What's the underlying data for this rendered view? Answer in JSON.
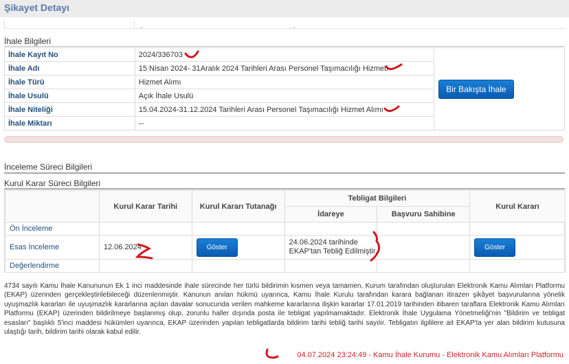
{
  "header": {
    "title": "Şikayet Detayı"
  },
  "ihale": {
    "section_title": "İhale Bilgileri",
    "rows": [
      {
        "label": "İhale Kayıt No",
        "value": "2024/336703"
      },
      {
        "label": "İhale Adı",
        "value": "15 Nisan 2024- 31Aralık 2024 Tarihleri Arası Personel Taşımacılığı Hizmeti"
      },
      {
        "label": "İhale Türü",
        "value": "Hizmet Alımı"
      },
      {
        "label": "İhale Usulü",
        "value": "Açık İhale Usulü"
      },
      {
        "label": "İhale Niteliği",
        "value": "15.04.2024-31.12.2024 Tarihleri Arası Personel Taşımacılığı Hizmet Alımı"
      },
      {
        "label": "İhale Miktarı",
        "value": "--"
      }
    ],
    "overview_button": "Bir Bakışta İhale"
  },
  "inceleme": {
    "section_title": "İnceleme Süreci Bilgileri"
  },
  "kurul": {
    "section_title": "Kurul Karar Süreci Bilgileri",
    "headers": {
      "tarih": "Kurul Karar Tarihi",
      "tutanak": "Kurul Kararı Tutanağı",
      "teblig": "Tebligat Bilgileri",
      "idare": "İdareye",
      "basvuru": "Başvuru Sahibine",
      "karar": "Kurul Kararı"
    },
    "rows": [
      {
        "stage": "Ön İnceleme",
        "tarih": "",
        "idare": ""
      },
      {
        "stage": "Esas İnceleme",
        "tarih": "12.06.2024",
        "idare_line1": "24.06.2024 tarihinde",
        "idare_line2": "EKAP'tan Tebliğ Edilmiştir."
      },
      {
        "stage": "Değerlendirme",
        "tarih": "",
        "idare": ""
      }
    ],
    "show_button": "Göster"
  },
  "notice": "4734 sayılı Kamu İhale Kanununun Ek 1 inci maddesinde ihale sürecinde her türlü bildirimin kısmen veya tamamen, Kurum tarafından oluşturulan Elektronik Kamu Alımları Platformu (EKAP) üzerinden gerçekleştirilebileceği düzenlenmiştir. Kanunun anılan hükmü uyarınca, Kamu İhale Kurulu tarafından karara bağlanan itirazen şikâyet başvurularına yönelik uyuşmazlık kararları ile uyuşmazlık kararlarına açılan davalar sonucunda verilen mahkeme kararlarına ilişkin kararlar 17.01.2019 tarihinden itibaren taraflara Elektronik Kamu Alımları Platformu (EKAP) üzerinden bildirilmeye başlanmış olup, zorunlu haller dışında posta ile tebligat yapılmamaktadır. Elektronik İhale Uygulama Yönetmeliği'nin \"Bildirim ve tebligat esasları\" başlıklı 5'inci maddesi hükümleri uyarınca, EKAP üzerinden yapılan tebligatlarda bildirim tarihi tebliğ tarihi sayılır. Tebligatın ilgililere ait EKAP'ta yer alan bildirim kutusuna ulaştığı tarih, bildirim tarihi olarak kabul edilir.",
  "footer": "04.07.2024 23:24:49 - Kamu İhale Kurumu - Elektronik Kamu Alımları Platformu",
  "colors": {
    "accent": "#1f4f7e",
    "button": "#0a5bb0",
    "mark": "#d0181e",
    "footer": "#c8242a"
  }
}
